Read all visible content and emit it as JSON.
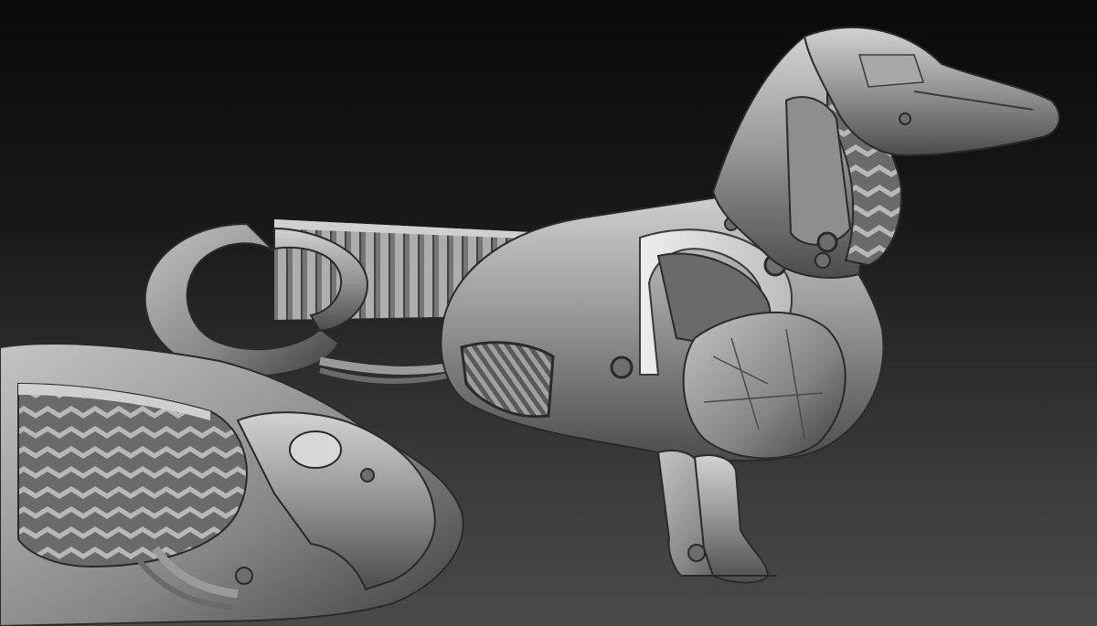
{
  "scene": {
    "subject": "robotic-dachshund-sculpt",
    "colors": {
      "background_top": "#0a0a0a",
      "background_bottom": "#4a4a4a",
      "clay_light": "#c8c8c8",
      "clay_mid": "#8a8a8a",
      "clay_dark": "#3a3a3a"
    }
  }
}
